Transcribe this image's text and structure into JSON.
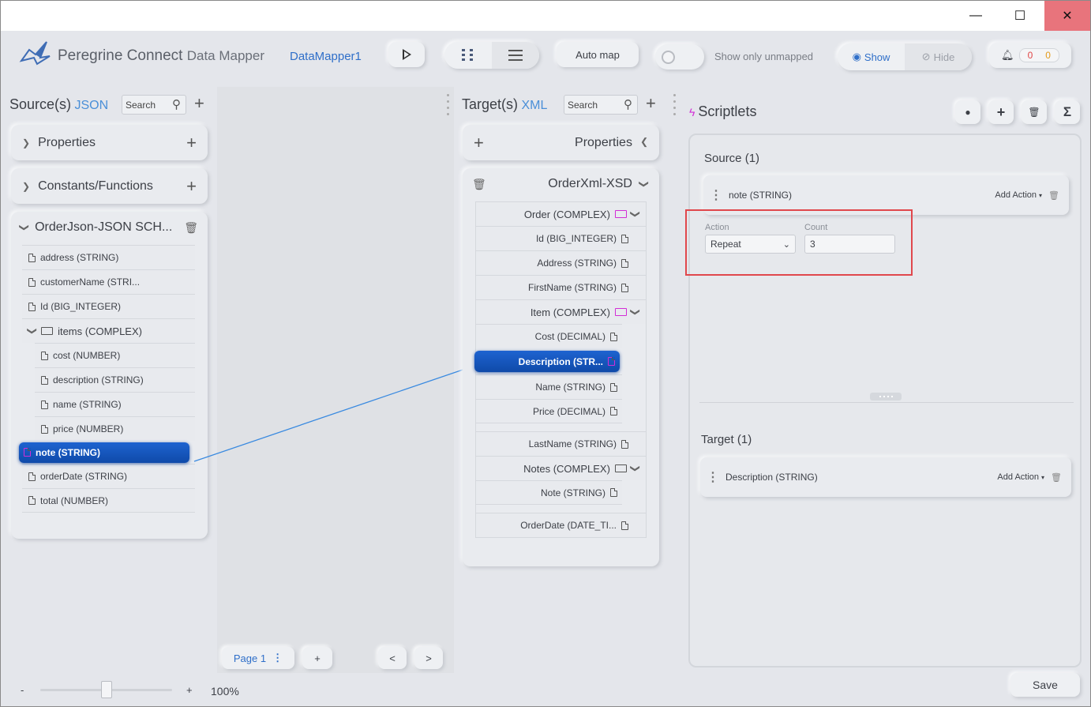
{
  "window": {
    "minimize": "—",
    "maximize": "☐",
    "close": "✕"
  },
  "app": {
    "brand": "Peregrine Connect",
    "product": "Data Mapper",
    "mapper_name": "DataMapper1"
  },
  "toolbar": {
    "run_icon": "play-icon",
    "auto_map": "Auto map",
    "show_only_unmapped": "Show only unmapped",
    "show": "Show",
    "hide": "Hide",
    "error_count": "0",
    "warning_count": "0"
  },
  "source": {
    "title": "Source(s)",
    "format": "JSON",
    "search_placeholder": "Search",
    "properties": "Properties",
    "constants": "Constants/Functions",
    "schema": "OrderJson-JSON SCH...",
    "fields": [
      "address (STRING)",
      "customerName (STRI...",
      "Id (BIG_INTEGER)",
      "items (COMPLEX)",
      "cost (NUMBER)",
      "description (STRING)",
      "name (STRING)",
      "price (NUMBER)",
      "note (STRING)",
      "orderDate (STRING)",
      "total (NUMBER)"
    ]
  },
  "target": {
    "title": "Target(s)",
    "format": "XML",
    "search_placeholder": "Search",
    "properties": "Properties",
    "schema": "OrderXml-XSD",
    "fields": [
      "Order (COMPLEX)",
      "Id (BIG_INTEGER)",
      "Address (STRING)",
      "FirstName (STRING)",
      "Item (COMPLEX)",
      "Cost (DECIMAL)",
      "Description (STR...",
      "Name (STRING)",
      "Price (DECIMAL)",
      "LastName (STRING)",
      "Notes (COMPLEX)",
      "Note (STRING)",
      "OrderDate (DATE_TI..."
    ]
  },
  "canvas": {
    "page": "Page 1",
    "add": "+",
    "prev": "<",
    "next": ">"
  },
  "zoom": {
    "minus": "-",
    "plus": "+",
    "value": "100%",
    "level": 0.5
  },
  "scriptlets": {
    "title": "Scriptlets",
    "sigma": "Σ",
    "source_header": "Source (1)",
    "source_item": "note (STRING)",
    "add_action": "Add Action",
    "action_label": "Action",
    "action_value": "Repeat",
    "count_label": "Count",
    "count_value": "3",
    "target_header": "Target (1)",
    "target_item": "Description (STRING)"
  },
  "footer": {
    "save": "Save"
  },
  "colors": {
    "accent": "#4a8fd8",
    "selected": "#1656bd",
    "highlight_box": "#e0474c",
    "error": "#e04545",
    "warning": "#e39a1a"
  }
}
